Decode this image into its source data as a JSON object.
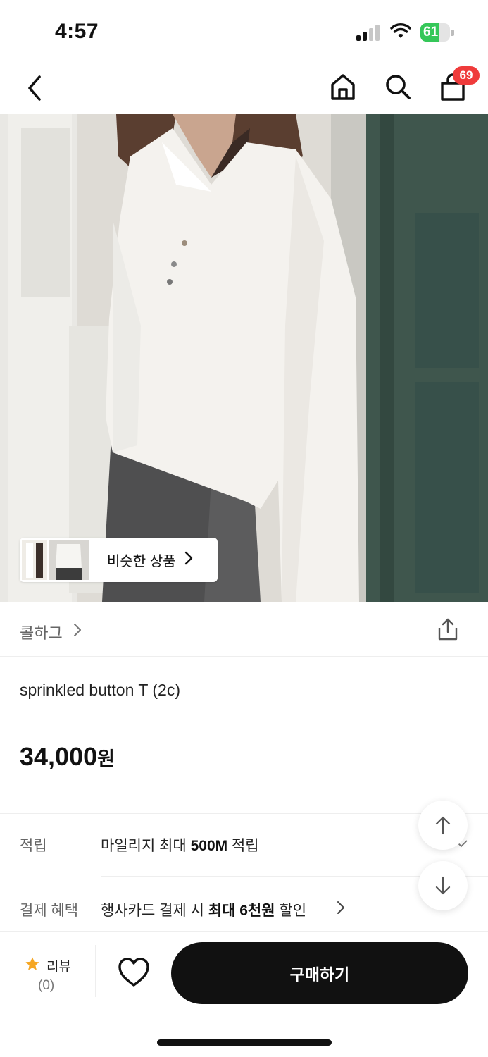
{
  "status_bar": {
    "time": "4:57",
    "battery": "61",
    "battery_level": 0.61
  },
  "nav": {
    "cart_count": "69"
  },
  "similar_products": {
    "label": "비슷한 상품"
  },
  "brand": {
    "name": "콜하그"
  },
  "product": {
    "name": "sprinkled button T (2c)",
    "price": "34,000",
    "price_unit": "원"
  },
  "info": {
    "points_label": "적립",
    "points_prefix": "마일리지 최대 ",
    "points_bold": "500M",
    "points_suffix": " 적립",
    "payment_label": "결제 혜택",
    "payment_prefix": "행사카드 결제 시 ",
    "payment_bold": "최대 6천원",
    "payment_suffix": " 할인"
  },
  "bottom": {
    "review_label": "리뷰",
    "review_count": "(0)",
    "buy_label": "구매하기"
  },
  "colors": {
    "accent": "#111111",
    "badge": "#ef3b3b",
    "star": "#f5a623",
    "battery": "#35c759"
  }
}
